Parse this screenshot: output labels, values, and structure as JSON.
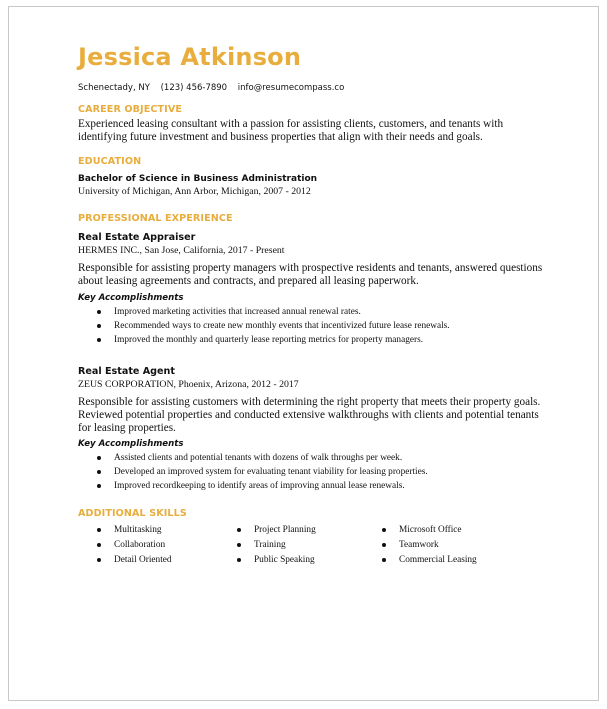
{
  "header": {
    "name": "Jessica Atkinson",
    "contact": {
      "location": "Schenectady, NY",
      "phone": "(123) 456-7890",
      "email": "info@resumecompass.co"
    },
    "accent_color": "#E8AD3C"
  },
  "career_objective": {
    "heading": "CAREER OBJECTIVE",
    "text": "Experienced leasing consultant with a passion for assisting clients, customers, and tenants with identifying future investment and business properties that align with their needs and goals."
  },
  "education": {
    "heading": "EDUCATION",
    "degree": "Bachelor of Science in Business Administration",
    "details": "University of Michigan, Ann Arbor, Michigan, 2007 - 2012"
  },
  "experience": {
    "heading": "PROFESSIONAL EXPERIENCE",
    "jobs": [
      {
        "title": "Real Estate Appraiser",
        "company": "HERMES INC., San Jose, California, 2017 - Present",
        "description": "Responsible for assisting property managers with prospective residents and tenants, answered questions about leasing agreements and contracts, and prepared all leasing paperwork.",
        "accomplishments_label": "Key Accomplishments",
        "accomplishments": [
          "Improved marketing activities that increased annual renewal rates.",
          "Recommended ways to create new monthly events that incentivized future lease renewals.",
          "Improved the monthly and quarterly lease reporting metrics for property managers."
        ]
      },
      {
        "title": "Real Estate Agent",
        "company": "ZEUS CORPORATION, Phoenix, Arizona, 2012 - 2017",
        "description": "Responsible for assisting customers with determining the right property that meets their property goals. Reviewed potential properties and conducted extensive walkthroughs with clients and potential tenants for leasing properties.",
        "accomplishments_label": "Key Accomplishments",
        "accomplishments": [
          "Assisted clients and potential tenants with dozens of walk throughs per week.",
          "Developed an improved system for evaluating tenant viability for leasing properties.",
          "Improved recordkeeping to identify areas of improving annual lease renewals."
        ]
      }
    ]
  },
  "skills": {
    "heading": "ADDITIONAL SKILLS",
    "columns": [
      [
        "Multitasking",
        "Collaboration",
        "Detail Oriented"
      ],
      [
        "Project Planning",
        "Training",
        "Public Speaking"
      ],
      [
        "Microsoft Office",
        "Teamwork",
        "Commercial Leasing"
      ]
    ]
  }
}
